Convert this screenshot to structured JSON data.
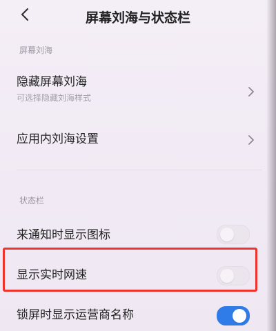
{
  "header": {
    "title": "屏幕刘海与状态栏"
  },
  "sections": [
    {
      "header": "屏幕刘海",
      "items": [
        {
          "label": "隐藏屏幕刘海",
          "subtitle": "可选择隐藏刘海样式",
          "control": "chevron-icon"
        },
        {
          "label": "应用内刘海设置",
          "control": "chevron-icon"
        }
      ]
    },
    {
      "header": "状态栏",
      "items": [
        {
          "label": "来通知时显示图标",
          "control": "toggle",
          "checked": false
        },
        {
          "label": "显示实时网速",
          "control": "toggle",
          "checked": false,
          "highlighted": true
        },
        {
          "label": "锁屏时显示运营商名称",
          "control": "toggle",
          "checked": true
        }
      ]
    }
  ],
  "colors": {
    "background": "#f3edf6",
    "accent": "#2f7ce8",
    "highlight": "#f0322d"
  }
}
